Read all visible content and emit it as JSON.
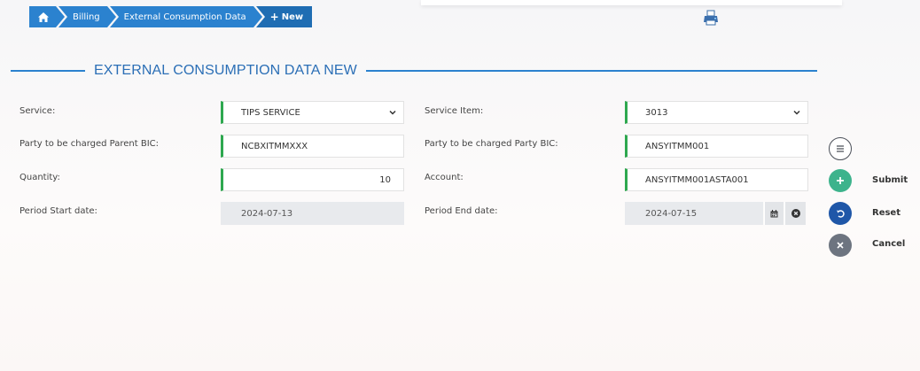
{
  "breadcrumb": {
    "home_icon": "home-icon",
    "items": [
      "Billing",
      "External Consumption Data"
    ],
    "current": "New"
  },
  "header": {
    "printer_icon": "printer-icon"
  },
  "section": {
    "title": "EXTERNAL CONSUMPTION DATA NEW"
  },
  "form": {
    "service": {
      "label": "Service:",
      "value": "TIPS SERVICE"
    },
    "service_item": {
      "label": "Service Item:",
      "value": "3013"
    },
    "parent_bic": {
      "label": "Party to be charged Parent BIC:",
      "value": "NCBXITMMXXX"
    },
    "party_bic": {
      "label": "Party to be charged Party BIC:",
      "value": "ANSYITMM001"
    },
    "quantity": {
      "label": "Quantity:",
      "value": "10"
    },
    "account": {
      "label": "Account:",
      "value": "ANSYITMM001ASTA001"
    },
    "period_start": {
      "label": "Period Start date:",
      "value": "2024-07-13"
    },
    "period_end": {
      "label": "Period End date:",
      "value": "2024-07-15"
    }
  },
  "actions": {
    "submit_label": "Submit",
    "reset_label": "Reset",
    "cancel_label": "Cancel"
  },
  "colors": {
    "accent": "#2b82cf",
    "field_marker": "#2ea84f",
    "submit": "#3db38c",
    "reset": "#1f57a8",
    "cancel": "#6d7480"
  }
}
